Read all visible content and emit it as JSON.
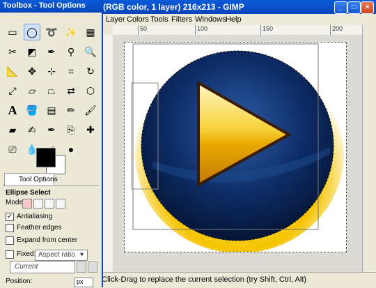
{
  "image_window": {
    "title": "(RGB color, 1 layer) 216x213 - GIMP",
    "menu": [
      "Layer",
      "Colors",
      "Tools",
      "Filters",
      "Windows",
      "Help"
    ],
    "ruler_ticks": [
      "50",
      "100",
      "150",
      "200"
    ],
    "status": "Click-Drag to replace the current selection (try Shift, Ctrl, Alt)",
    "window_buttons": {
      "minimize": "_",
      "maximize": "□",
      "close": "×"
    }
  },
  "toolbox": {
    "title": "Toolbox - Tool Options",
    "tool_options_tab": "Tool Options",
    "tool_name": "Ellipse Select",
    "mode_label": "Mode:",
    "antialiasing_label": "Antialiasing",
    "antialiasing_checked": true,
    "feather_label": "Feather edges",
    "expand_label": "Expand from center",
    "fixed_label": "Fixed:",
    "aspect_option": "Aspect ratio",
    "preset_value": "Current",
    "position_label": "Position:",
    "position_unit": "px",
    "foreground_color": "#000000",
    "background_color": "#ffffff"
  },
  "icons": [
    "rect-select-icon",
    "ellipse-select-icon",
    "lasso-icon",
    "fuzzy-select-icon",
    "select-by-color-icon",
    "scissors-icon",
    "foreground-select-icon",
    "paths-icon",
    "color-picker-icon",
    "zoom-icon",
    "measure-icon",
    "move-icon",
    "align-icon",
    "crop-icon",
    "rotate-icon",
    "scale-icon",
    "shear-icon",
    "perspective-icon",
    "flip-icon",
    "cage-icon",
    "text-icon",
    "bucket-fill-icon",
    "blend-icon",
    "pencil-icon",
    "paintbrush-icon",
    "eraser-icon",
    "airbrush-icon",
    "ink-icon",
    "clone-icon",
    "heal-icon",
    "perspective-clone-icon",
    "blur-icon",
    "smudge-icon",
    "dodge-burn-icon",
    "dodge-icon"
  ]
}
